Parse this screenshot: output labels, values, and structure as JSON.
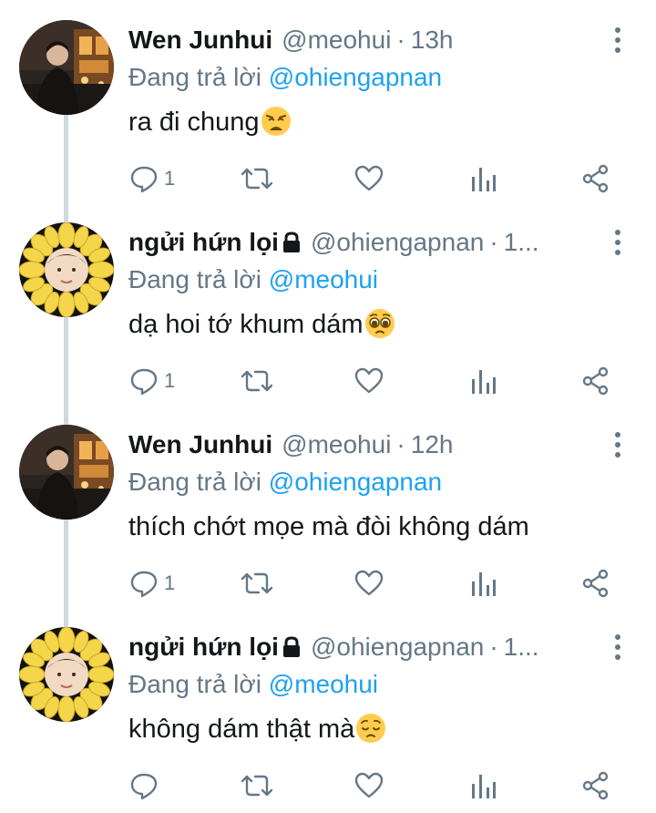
{
  "colors": {
    "text": "#14171a",
    "secondary": "#657786",
    "link": "#1da1f2",
    "thread_line": "#cfd9de"
  },
  "tweets": [
    {
      "name": "Wen Junhui",
      "handle": "@meohui",
      "separator": "·",
      "time": "13h",
      "locked": false,
      "replying_prefix": "Đang trả lời",
      "replying_to": "@ohiengapnan",
      "text": "ra đi chung",
      "emoji": "weary-face-emoji",
      "reply_count": "1",
      "avatar": "photo-man-street-night"
    },
    {
      "name": "ngửi hứn lọi",
      "handle": "@ohiengapnan",
      "separator": "·",
      "time": "1...",
      "locked": true,
      "replying_prefix": "Đang trả lời",
      "replying_to": "@meohui",
      "text": "dạ hoi tớ khum dám",
      "emoji": "pleading-face-emoji",
      "reply_count": "1",
      "avatar": "photo-sunflower-face"
    },
    {
      "name": "Wen Junhui",
      "handle": "@meohui",
      "separator": "·",
      "time": "12h",
      "locked": false,
      "replying_prefix": "Đang trả lời",
      "replying_to": "@ohiengapnan",
      "text": "thích chớt mọe mà đòi không dám",
      "emoji": "",
      "reply_count": "1",
      "avatar": "photo-man-street-night"
    },
    {
      "name": "ngửi hứn lọi",
      "handle": "@ohiengapnan",
      "separator": "·",
      "time": "1...",
      "locked": true,
      "replying_prefix": "Đang trả lời",
      "replying_to": "@meohui",
      "text": "không dám thật mà",
      "emoji": "pensive-face-emoji",
      "reply_count": "",
      "avatar": "photo-sunflower-face"
    }
  ],
  "actions": [
    "reply-icon",
    "retweet-icon",
    "like-icon",
    "analytics-icon",
    "share-icon"
  ]
}
